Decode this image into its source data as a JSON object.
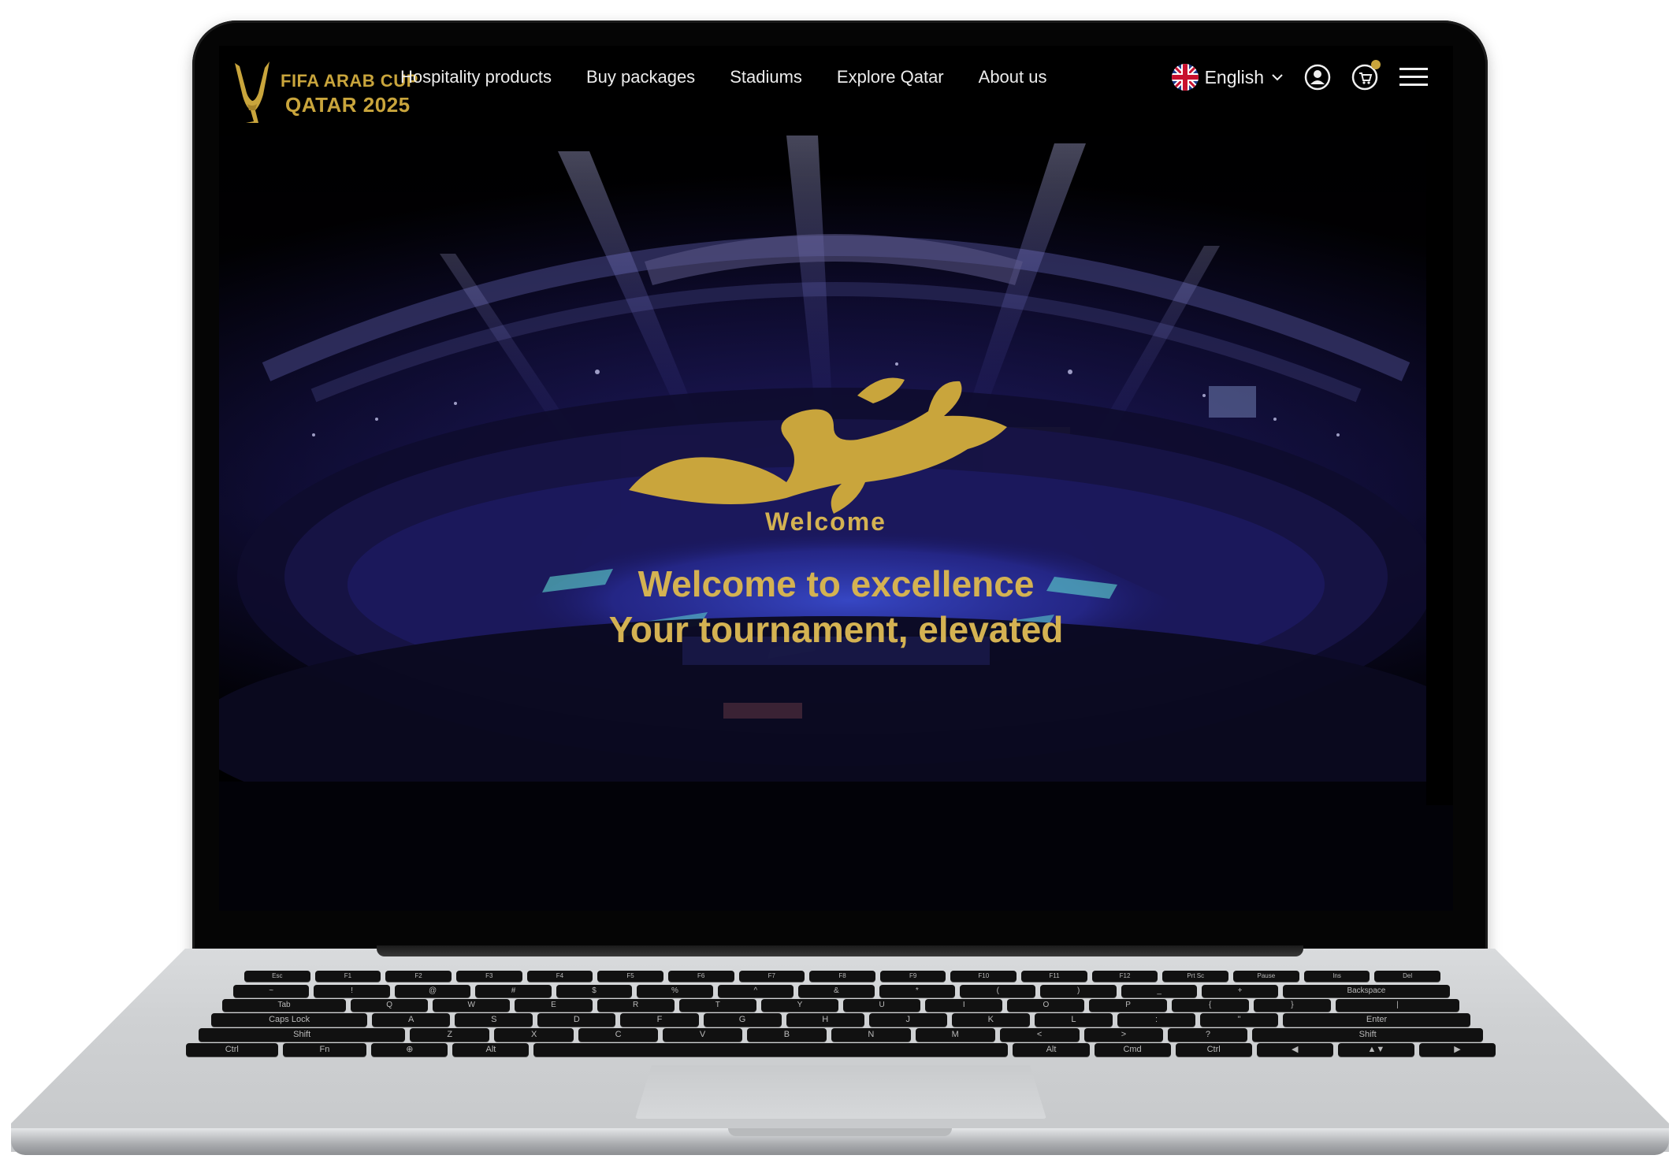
{
  "brand": {
    "line1": "FIFA ARAB CUP",
    "line2": "QATAR 2025",
    "gold": "#c9a53c"
  },
  "nav": {
    "links": [
      "Hospitality products",
      "Buy packages",
      "Stadiums",
      "Explore Qatar",
      "About us"
    ],
    "language": "English",
    "icons": [
      "uk-flag-icon",
      "chevron-down-icon",
      "user-icon",
      "cart-icon",
      "menu-icon"
    ]
  },
  "hero": {
    "logo_subtitle": "Welcome",
    "title_line1": "Welcome to excellence",
    "title_line2": "Your tournament, elevated",
    "accent": "#d4b252"
  },
  "keyboard": {
    "row_fn": [
      "Esc",
      "F1",
      "F2",
      "F3",
      "F4",
      "F5",
      "F6",
      "F7",
      "F8",
      "F9",
      "F10",
      "F11",
      "F12",
      "Prt Sc",
      "Pause",
      "Ins",
      "Del"
    ],
    "row_num": [
      "~",
      "!",
      "@",
      "#",
      "$",
      "%",
      "^",
      "&",
      "*",
      "(",
      ")",
      "_",
      "+",
      "Backspace"
    ],
    "row_q": [
      "Tab",
      "Q",
      "W",
      "E",
      "R",
      "T",
      "Y",
      "U",
      "I",
      "O",
      "P",
      "{",
      "}",
      "|"
    ],
    "row_a": [
      "Caps Lock",
      "A",
      "S",
      "D",
      "F",
      "G",
      "H",
      "J",
      "K",
      "L",
      ":",
      "\"",
      "Enter"
    ],
    "row_z": [
      "Shift",
      "Z",
      "X",
      "C",
      "V",
      "B",
      "N",
      "M",
      "<",
      ">",
      "?",
      "Shift"
    ],
    "row_bottom": [
      "Ctrl",
      "Fn",
      "⊕",
      "Alt",
      "",
      "Alt",
      "Cmd",
      "Ctrl",
      "◀",
      "▲▼",
      "▶"
    ]
  }
}
